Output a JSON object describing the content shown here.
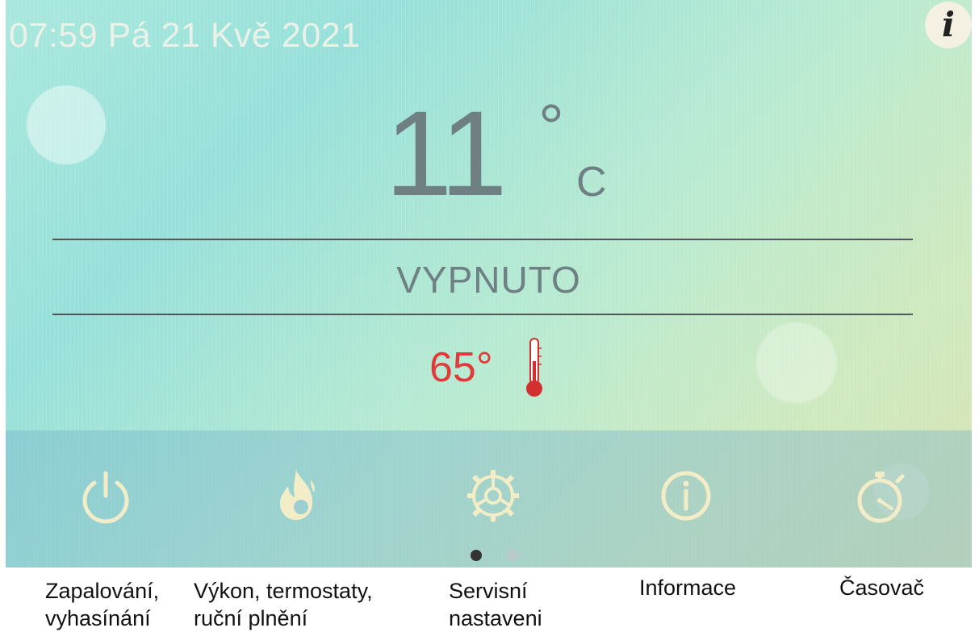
{
  "status_bar": {
    "datetime": "07:59 Pá 21 Kvě 2021",
    "info_icon_label": "i"
  },
  "main": {
    "room_temperature": "11",
    "degree_symbol": "°",
    "unit": "C",
    "status": "VYPNUTO",
    "water_temperature": "65°"
  },
  "toolbar": {
    "buttons": [
      {
        "icon": "power-icon"
      },
      {
        "icon": "flame-icon"
      },
      {
        "icon": "gear-icon"
      },
      {
        "icon": "info-circle-icon"
      },
      {
        "icon": "stopwatch-icon"
      }
    ],
    "pager": {
      "pages": 2,
      "current": 1
    }
  },
  "captions": [
    "Zapalování,\nvyhasínání",
    "Výkon, termostaty,\nruční plnění",
    "Servisní\nnastaveni",
    "Informace",
    "Časovač"
  ],
  "colors": {
    "accent_icon": "#f3edc7",
    "temperature_text": "#6f8083",
    "water_text": "#e23a3a",
    "pager_active": "#333333",
    "pager_inactive": "#b9c9cc"
  }
}
